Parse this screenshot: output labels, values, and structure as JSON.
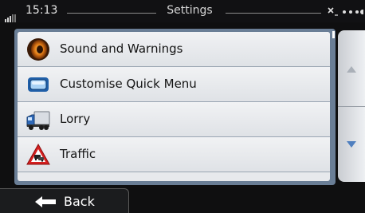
{
  "status": {
    "time": "15:13",
    "title": "Settings"
  },
  "menu": {
    "items": [
      {
        "label": "Sound and Warnings",
        "icon": "speaker-icon"
      },
      {
        "label": "Customise Quick Menu",
        "icon": "quick-menu-icon"
      },
      {
        "label": "Lorry",
        "icon": "lorry-icon"
      },
      {
        "label": "Traffic",
        "icon": "traffic-warning-icon"
      }
    ]
  },
  "scroll": {
    "up_icon": "scroll-up-arrow-icon",
    "down_icon": "scroll-down-arrow-icon"
  },
  "footer": {
    "back_label": "Back"
  },
  "colors": {
    "panel": "#6a7e96",
    "list_bg": "#e7e9ec",
    "scroll_arrow_active": "#4f7fbf",
    "scroll_arrow_inactive": "#aab0b8"
  }
}
